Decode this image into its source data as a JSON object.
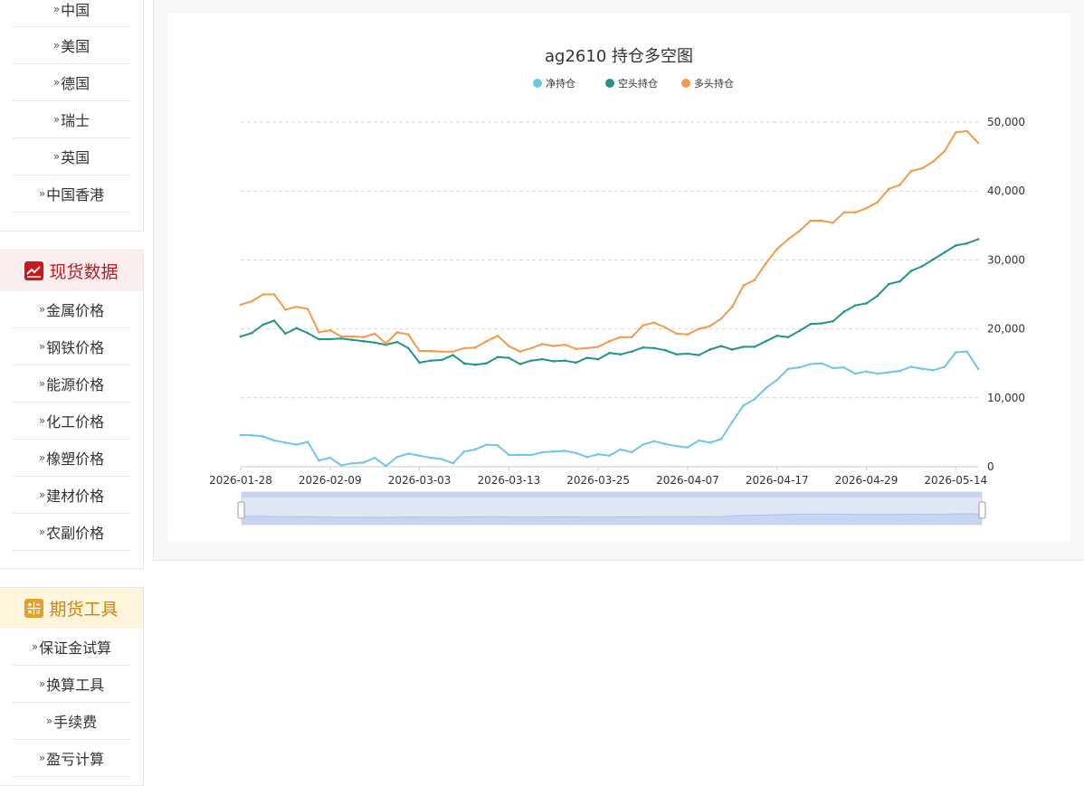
{
  "sidebar": {
    "country_items": [
      {
        "label": "中国"
      },
      {
        "label": "美国"
      },
      {
        "label": "德国"
      },
      {
        "label": "瑞士"
      },
      {
        "label": "英国"
      },
      {
        "label": "中国香港"
      }
    ],
    "spot_section": {
      "title": "现货数据",
      "icon": "trend-chart-icon",
      "color": "#c9171e",
      "items": [
        {
          "label": "金属价格"
        },
        {
          "label": "钢铁价格"
        },
        {
          "label": "能源价格"
        },
        {
          "label": "化工价格"
        },
        {
          "label": "橡塑价格"
        },
        {
          "label": "建材价格"
        },
        {
          "label": "农副价格"
        }
      ]
    },
    "futures_tools_section": {
      "title": "期货工具",
      "icon": "calculator-icon",
      "color": "#e0a22c",
      "items": [
        {
          "label": "保证金试算"
        },
        {
          "label": "换算工具"
        },
        {
          "label": "手续费"
        },
        {
          "label": "盈亏计算"
        }
      ]
    },
    "arrow_glyph": "»"
  },
  "chart_data": {
    "type": "line",
    "title": "ag2610 持仓多空图",
    "legend_position": "top-center",
    "grid": true,
    "y_axis_position": "right",
    "ylim": [
      0,
      50000
    ],
    "y_ticks": [
      "0",
      "10,000",
      "20,000",
      "30,000",
      "40,000",
      "50,000"
    ],
    "x_tick_labels": [
      "2026-01-28",
      "2026-02-09",
      "2026-03-03",
      "2026-03-13",
      "2026-03-25",
      "2026-04-07",
      "2026-04-17",
      "2026-04-29",
      "2026-05-14"
    ],
    "x_tick_indices": [
      0,
      8,
      16,
      24,
      32,
      40,
      48,
      56,
      64
    ],
    "series": [
      {
        "name": "净持仓",
        "color": "#6ec6e8",
        "values": [
          4600,
          4550,
          4400,
          3800,
          3500,
          3200,
          3600,
          900,
          1300,
          200,
          500,
          600,
          1300,
          100,
          1400,
          1900,
          1600,
          1300,
          1100,
          500,
          2200,
          2500,
          3200,
          3100,
          1700,
          1700,
          1700,
          2100,
          2200,
          2300,
          2000,
          1400,
          1800,
          1600,
          2500,
          2100,
          3200,
          3700,
          3300,
          3000,
          2800,
          3800,
          3500,
          4000,
          6500,
          8900,
          9800,
          11400,
          12600,
          14200,
          14400,
          14900,
          15000,
          14300,
          14400,
          13500,
          13800,
          13500,
          13700,
          13900,
          14500,
          14200,
          14000,
          14500,
          16600,
          16700,
          14200
        ]
      },
      {
        "name": "空头持仓",
        "color": "#22948c",
        "values": [
          18900,
          19400,
          20600,
          21200,
          19300,
          20100,
          19400,
          18500,
          18500,
          18600,
          18400,
          18200,
          18000,
          17700,
          18100,
          17200,
          15100,
          15400,
          15500,
          16200,
          15000,
          14800,
          15000,
          15900,
          15800,
          14900,
          15400,
          15600,
          15300,
          15400,
          15100,
          15800,
          15600,
          16500,
          16300,
          16700,
          17300,
          17200,
          16900,
          16300,
          16400,
          16200,
          17000,
          17500,
          17000,
          17400,
          17400,
          18200,
          19000,
          18800,
          19700,
          20700,
          20800,
          21100,
          22500,
          23400,
          23700,
          24800,
          26500,
          26900,
          28400,
          29100,
          30100,
          31100,
          32100,
          32400,
          33000
        ]
      },
      {
        "name": "多头持仓",
        "color": "#f59a49",
        "values": [
          23500,
          24000,
          25000,
          25000,
          22800,
          23200,
          22900,
          19500,
          19800,
          18900,
          18900,
          18800,
          19300,
          17900,
          19500,
          19200,
          16800,
          16800,
          16700,
          16700,
          17200,
          17300,
          18200,
          19000,
          17500,
          16700,
          17200,
          17800,
          17500,
          17700,
          17100,
          17200,
          17400,
          18200,
          18800,
          18800,
          20500,
          20900,
          20200,
          19300,
          19200,
          20000,
          20400,
          21500,
          23200,
          26300,
          27100,
          29500,
          31600,
          33000,
          34200,
          35700,
          35700,
          35400,
          36900,
          36900,
          37500,
          38400,
          40300,
          40900,
          42900,
          43300,
          44300,
          45800,
          48500,
          48700,
          47000
        ]
      }
    ]
  }
}
